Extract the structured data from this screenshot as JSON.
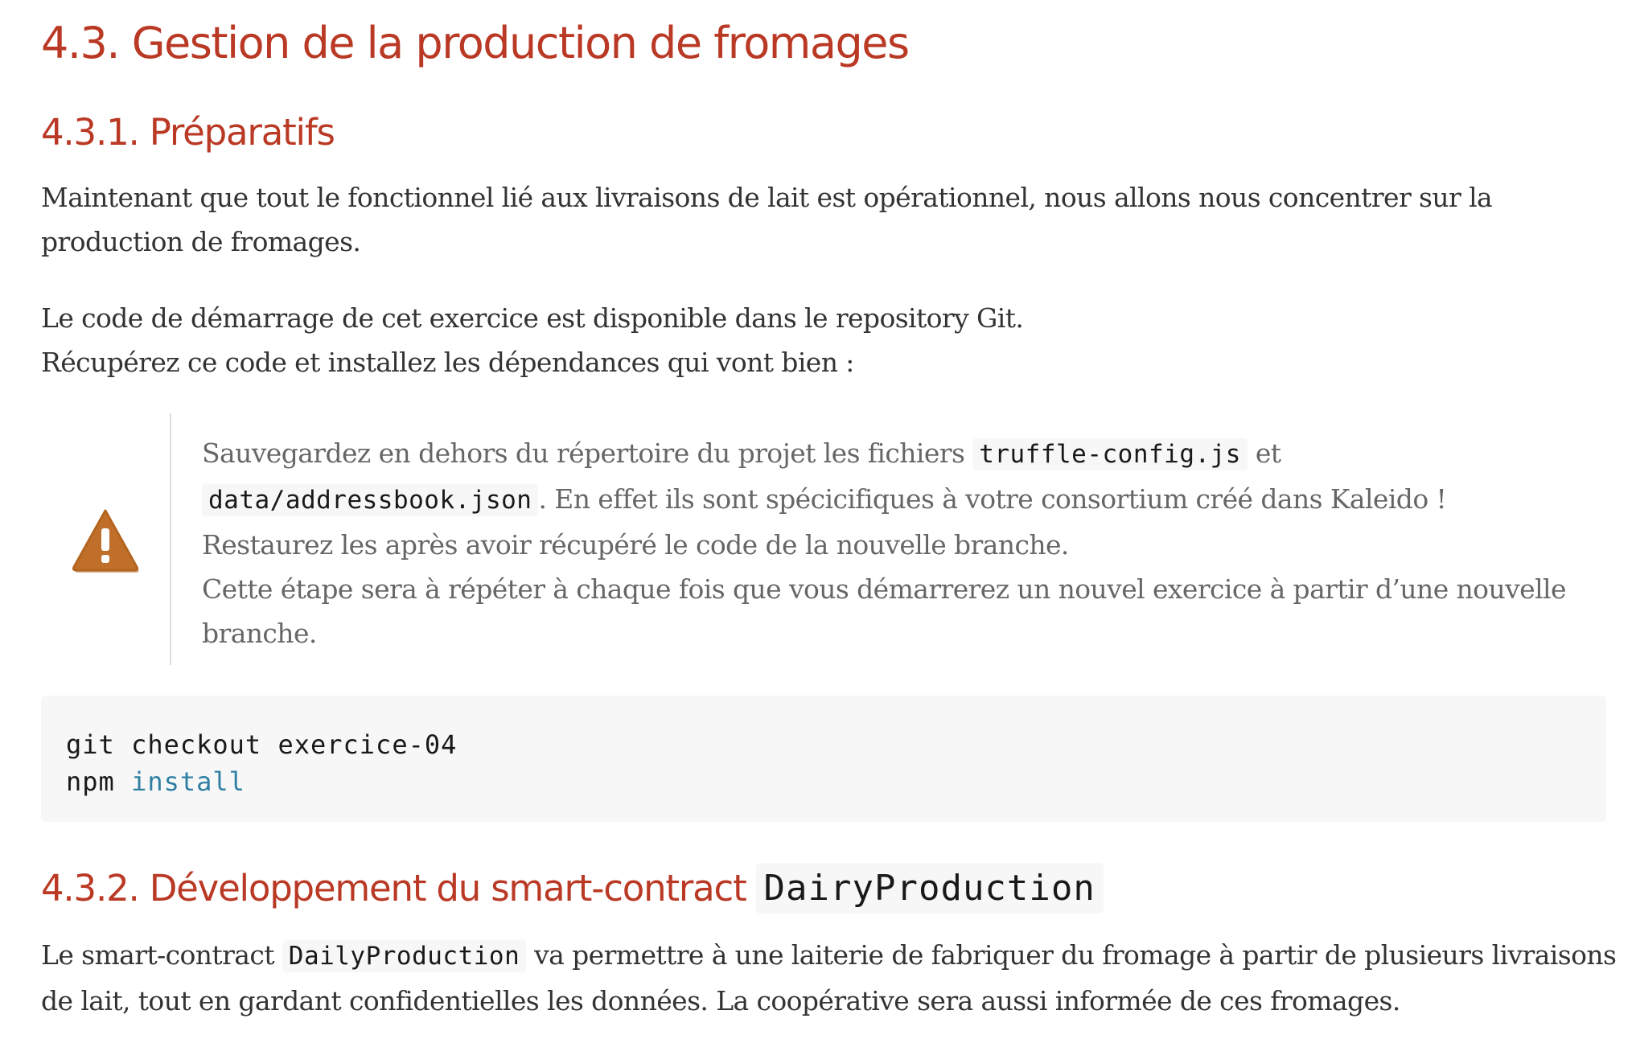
{
  "section": {
    "title": "4.3. Gestion de la production de fromages"
  },
  "preparatifs": {
    "title": "4.3.1. Préparatifs",
    "intro_lines": [
      "Maintenant que tout le fonctionnel lié aux livraisons de lait est opérationnel, nous allons nous concentrer sur la",
      "production de fromages."
    ],
    "code_lines": [
      "Le code de démarrage de cet exercice est disponible dans le repository Git.",
      "Récupérez ce code et installez les dépendances qui vont bien :"
    ]
  },
  "warning": {
    "icon": "warning-triangle-icon",
    "icon_color": "#bf6900",
    "line1_before": "Sauvegardez en dehors du répertoire du projet les fichiers ",
    "line1_code": "truffle-config.js",
    "line1_after": " et",
    "line2_code": "data/addressbook.json",
    "line2_after": ". En effet ils sont spécicifiques à votre consortium créé dans Kaleido !",
    "line3": "Restaurez les après avoir récupéré le code de la nouvelle branche.",
    "line4": "Cette étape sera à répéter à chaque fois que vous démarrerez un nouvel exercice à partir d’une nouvelle",
    "line5": "branche."
  },
  "listing": {
    "line1": "git checkout exercice-04",
    "line2_cmd": "npm ",
    "line2_keyword": "install"
  },
  "developpement": {
    "title": "4.3.2. Développement du smart-contract",
    "title_code": "DairyProduction",
    "line1_before": "Le smart-contract ",
    "line1_code": "DailyProduction",
    "line1_after": " va permettre à une laiterie de fabriquer du fromage à partir de plusieurs livraisons",
    "line2": "de lait, tout en gardant confidentielles les données. La coopérative sera aussi informée de ces fromages."
  }
}
